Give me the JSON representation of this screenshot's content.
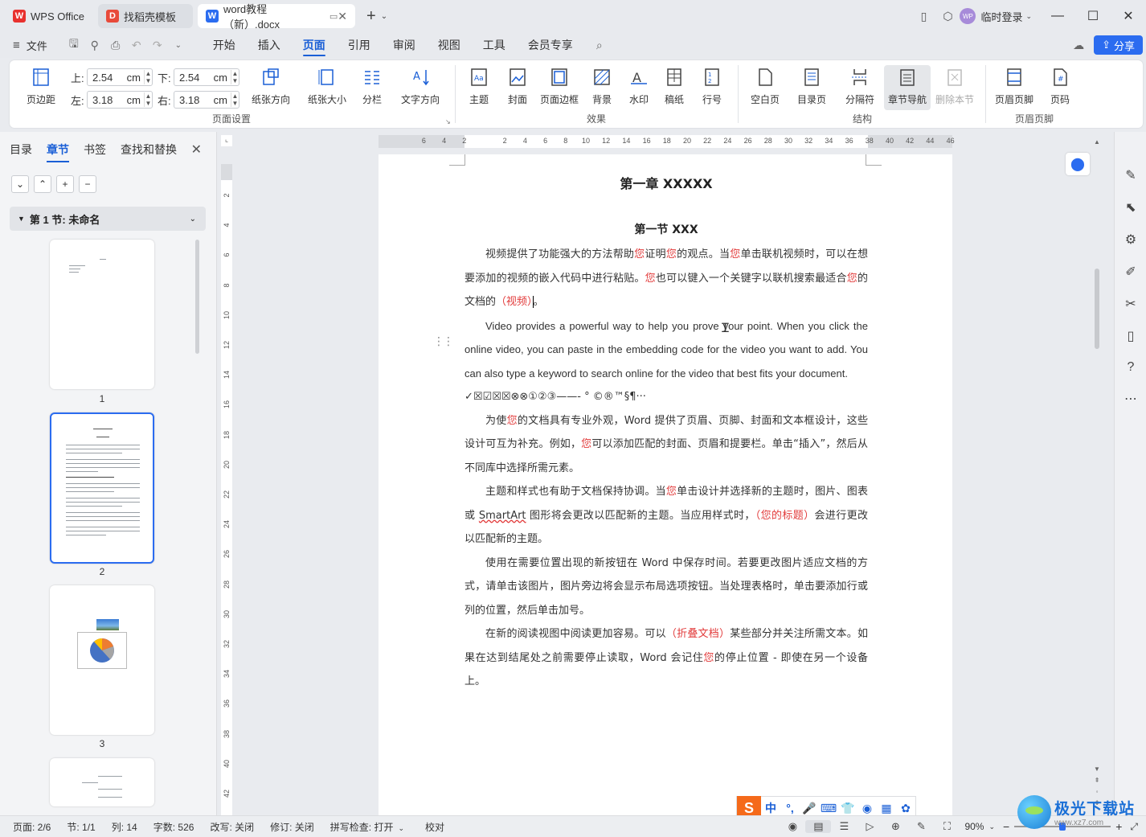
{
  "titlebar": {
    "tabs": [
      {
        "label": "WPS Office",
        "logo": "W"
      },
      {
        "label": "找稻壳模板",
        "logo": "D"
      },
      {
        "label": "word教程（新）.docx",
        "logo": "W"
      }
    ],
    "user": "临时登录",
    "avatar_text": "WP"
  },
  "menubar": {
    "file": "文件",
    "tabs": [
      "开始",
      "插入",
      "页面",
      "引用",
      "审阅",
      "视图",
      "工具",
      "会员专享"
    ],
    "active_tab": "页面",
    "share": "分享"
  },
  "ribbon": {
    "margins_label": "页边距",
    "top_label": "上:",
    "top_value": "2.54",
    "bottom_label": "下:",
    "bottom_value": "2.54",
    "left_label": "左:",
    "left_value": "3.18",
    "right_label": "右:",
    "right_value": "3.18",
    "unit": "cm",
    "page_setup_buttons": [
      "纸张方向",
      "纸张大小",
      "分栏",
      "文字方向"
    ],
    "group_page_setup": "页面设置",
    "effect_buttons": [
      "主题",
      "封面",
      "页面边框",
      "背景",
      "水印",
      "稿纸",
      "行号"
    ],
    "group_effect": "效果",
    "structure_buttons": [
      "空白页",
      "目录页",
      "分隔符",
      "章节导航",
      "删除本节"
    ],
    "group_structure": "结构",
    "header_buttons": [
      "页眉页脚",
      "页码"
    ],
    "group_header": "页眉页脚"
  },
  "leftpanel": {
    "tabs": [
      "目录",
      "章节",
      "书签",
      "查找和替换"
    ],
    "active_tab": "章节",
    "section_label": "第 1 节: 未命名",
    "pages": [
      "1",
      "2",
      "3"
    ]
  },
  "ruler": {
    "h_numbers": [
      "6",
      "4",
      "2",
      "2",
      "4",
      "6",
      "8",
      "10",
      "12",
      "14",
      "16",
      "18",
      "20",
      "22",
      "24",
      "26",
      "28",
      "30",
      "32",
      "34",
      "36",
      "38",
      "40",
      "42",
      "44",
      "46"
    ],
    "v_numbers": [
      "2",
      "4",
      "6",
      "8",
      "10",
      "12",
      "14",
      "16",
      "18",
      "20",
      "22",
      "24",
      "26",
      "28",
      "30",
      "32",
      "34",
      "36",
      "38",
      "40",
      "42"
    ]
  },
  "document": {
    "chapter": "第一章  XXXXX",
    "section": "第一节  XXX",
    "p1_a": "视频提供了功能强大的方法帮助",
    "p1_b": "您",
    "p1_c": "证明",
    "p1_d": "您",
    "p1_e": "的观点。当",
    "p1_f": "您",
    "p1_g": "单击联机视频时，可以在想要添加的视频的嵌入代码中进行粘贴。",
    "p1_h": "您",
    "p1_i": "也可以键入一个关键字以联机搜索最适合",
    "p1_j": "您",
    "p1_k": "的文档的",
    "p1_l": "（视频）",
    "p1_m": "。",
    "p2": "Video provides a powerful way to help you prove your point. When you click the online video, you can paste in the embedding code for the video you want to add. You can also type a keyword to search online for the video that best fits your document.",
    "symbols": "✓☒☑☒☒⊗⊗①②③——-    °   ©®™§¶···",
    "p3_a": "为使",
    "p3_b": "您",
    "p3_c": "的文档具有专业外观，Word 提供了页眉、页脚、封面和文本框设计，这些设计可互为补充。例如，",
    "p3_d": "您",
    "p3_e": "可以添加匹配的封面、页眉和提要栏。单击“插入”，然后从不同库中选择所需元素。",
    "p4_a": "主题和样式也有助于文档保持协调。当",
    "p4_b": "您",
    "p4_c": "单击设计并选择新的主题时，图片、图表或 ",
    "p4_d": "SmartArt",
    "p4_e": " 图形将会更改以匹配新的主题。当应用样式时，",
    "p4_f": "（您的标题）",
    "p4_g": "会进行更改以匹配新的主题。",
    "p5": "使用在需要位置出现的新按钮在 Word 中保存时间。若要更改图片适应文档的方式，请单击该图片，图片旁边将会显示布局选项按钮。当处理表格时，单击要添加行或列的位置，然后单击加号。",
    "p6_a": "在新的阅读视图中阅读更加容易。可以",
    "p6_b": "（折叠文档）",
    "p6_c": "某些部分并关注所需文本。如果在达到结尾处之前需要停止读取，Word 会记住",
    "p6_d": "您",
    "p6_e": "的停止位置 - 即使在另一个设备上。"
  },
  "ime": {
    "logo": "S",
    "mode": "中"
  },
  "statusbar": {
    "page": "页面: 2/6",
    "section": "节: 1/1",
    "column": "列: 14",
    "words": "字数: 526",
    "overwrite": "改写: 关闭",
    "revision": "修订: 关闭",
    "spellcheck": "拼写检查: 打开",
    "proof": "校对",
    "zoom": "90%"
  },
  "watermark": {
    "title": "极光下载站",
    "url": "www.xz7.com"
  },
  "colors": {
    "accent": "#1a5fd6",
    "share": "#2b6cf0",
    "red_text": "#e23b3b"
  }
}
